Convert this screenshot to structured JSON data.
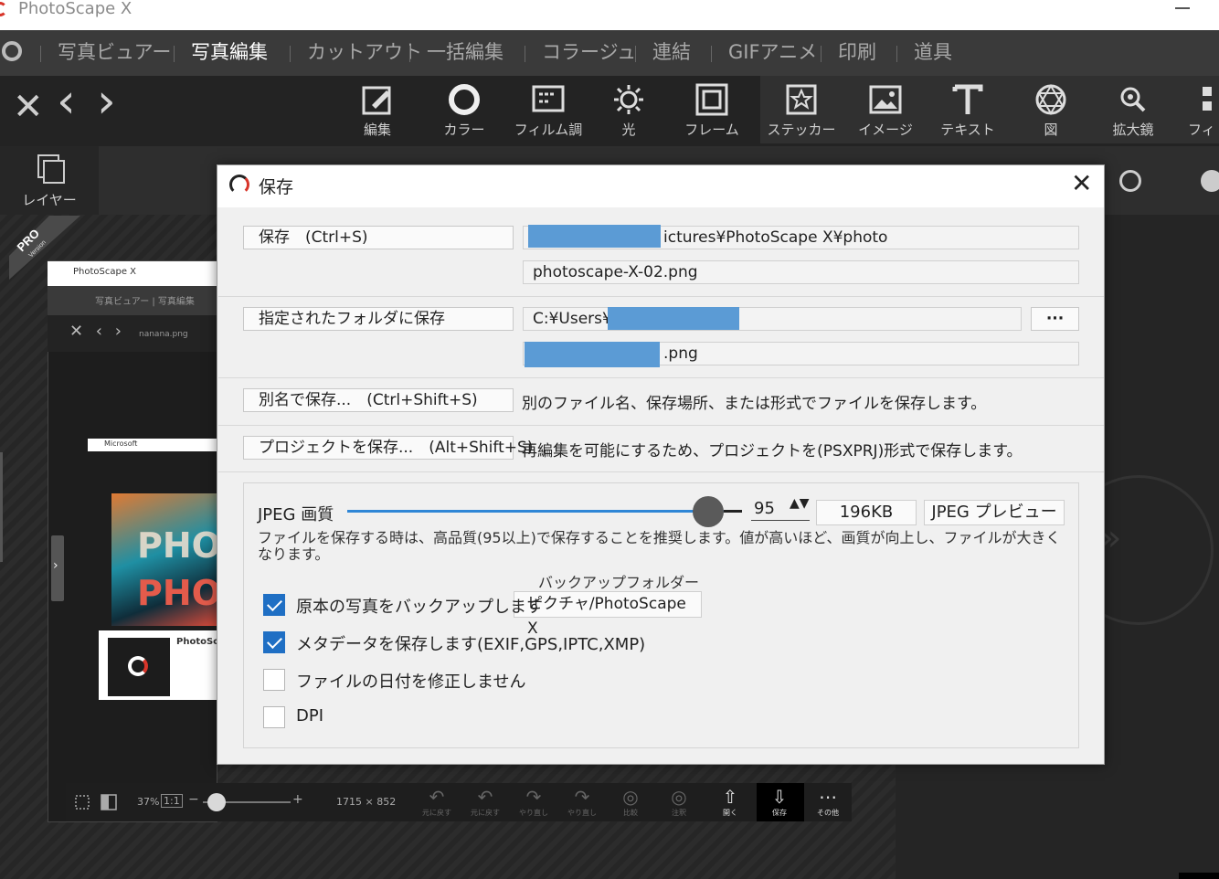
{
  "app": {
    "title": "PhotoScape X"
  },
  "menu": {
    "items": [
      {
        "label": "写真ビュアー",
        "active": false
      },
      {
        "label": "写真編集",
        "active": true
      },
      {
        "label": "カットアウト",
        "active": false
      },
      {
        "label": "一括編集",
        "active": false
      },
      {
        "label": "コラージュ",
        "active": false
      },
      {
        "label": "連結",
        "active": false
      },
      {
        "label": "GIFアニメ",
        "active": false
      },
      {
        "label": "印刷",
        "active": false
      },
      {
        "label": "道具",
        "active": false
      }
    ]
  },
  "toolbar": {
    "nav": {
      "close": "✕",
      "prev": "‹",
      "next": "›"
    },
    "tools": [
      {
        "label": "編集",
        "icon": "edit-icon"
      },
      {
        "label": "カラー",
        "icon": "color-circle-icon"
      },
      {
        "label": "フィルム調",
        "icon": "film-icon"
      },
      {
        "label": "光",
        "icon": "sun-icon"
      },
      {
        "label": "フレーム",
        "icon": "frame-icon"
      },
      {
        "label": "ステッカー",
        "icon": "sticker-icon"
      },
      {
        "label": "イメージ",
        "icon": "image-icon"
      },
      {
        "label": "テキスト",
        "icon": "text-icon"
      },
      {
        "label": "図",
        "icon": "shape-icon"
      },
      {
        "label": "拡大鏡",
        "icon": "magnifier-icon"
      },
      {
        "label": "フィル",
        "icon": "filter-icon"
      }
    ]
  },
  "sidepanel": {
    "layer_label": "レイヤー",
    "pro_badge": "PRO",
    "pro_sub": "Version"
  },
  "inner_preview": {
    "title": "PhotoScape X",
    "menu": "写真ビュアー | 写真編集",
    "nav": "✕ ‹ ›",
    "filename": "nanana.png",
    "strip": "Microsoft",
    "art1": "PHO",
    "art2": "PHO",
    "card": "PhotoSc"
  },
  "bottombar": {
    "zoom_percent": "37%",
    "zoom_fit": "1:1",
    "minus": "−",
    "plus": "+",
    "zoom_level": 0.1,
    "dimensions": "1715 × 852",
    "actions": [
      {
        "label": "元に戻す",
        "icon": "undo-icon",
        "glyph": "↶"
      },
      {
        "label": "やり直し",
        "icon": "redo-icon",
        "glyph": "↷"
      },
      {
        "label": "比較",
        "icon": "compare-icon",
        "glyph": "◎"
      },
      {
        "label": "注釈",
        "icon": "note-icon",
        "glyph": "◎"
      },
      {
        "label": "開く",
        "icon": "open-icon",
        "glyph": "⇧"
      },
      {
        "label": "保存",
        "icon": "save-icon",
        "glyph": "⇩"
      },
      {
        "label": "その他",
        "icon": "more-icon",
        "glyph": "⋯"
      }
    ]
  },
  "dialog": {
    "title": "保存",
    "close": "✕",
    "save": {
      "button": "保存　(Ctrl+S)",
      "path": "ictures¥PhotoScape X¥photo",
      "filename": "photoscape-X-02.png"
    },
    "save_folder": {
      "button": "指定されたフォルダに保存",
      "path": "C:¥Users¥",
      "browse": "···",
      "filename": ".png"
    },
    "save_as": {
      "button": "別名で保存...　(Ctrl+Shift+S)",
      "desc": "別のファイル名、保存場所、または形式でファイルを保存します。"
    },
    "save_project": {
      "button": "プロジェクトを保存...　(Alt+Shift+S)",
      "desc": "再編集を可能にするため、プロジェクトを(PSXPRJ)形式で保存します。"
    },
    "jpeg": {
      "label": "JPEG 画質",
      "quality": "95",
      "quality_level": 0.92,
      "spin": "▲▼",
      "size": "196KB",
      "preview_button": "JPEG プレビュー",
      "note": "ファイルを保存する時は、高品質(95以上)で保存することを推奨します。値が高いほど、画質が向上し、ファイルが大きくなります。"
    },
    "backup_folder_label": "バックアップフォルダー",
    "backup_folder": "ピクチャ/PhotoScape X",
    "checkboxes": [
      {
        "label": "原本の写真をバックアップします",
        "checked": true
      },
      {
        "label": "メタデータを保存します(EXIF,GPS,IPTC,XMP)",
        "checked": true
      },
      {
        "label": "ファイルの日付を修正しません",
        "checked": false
      },
      {
        "label": "DPI",
        "checked": false
      }
    ]
  }
}
